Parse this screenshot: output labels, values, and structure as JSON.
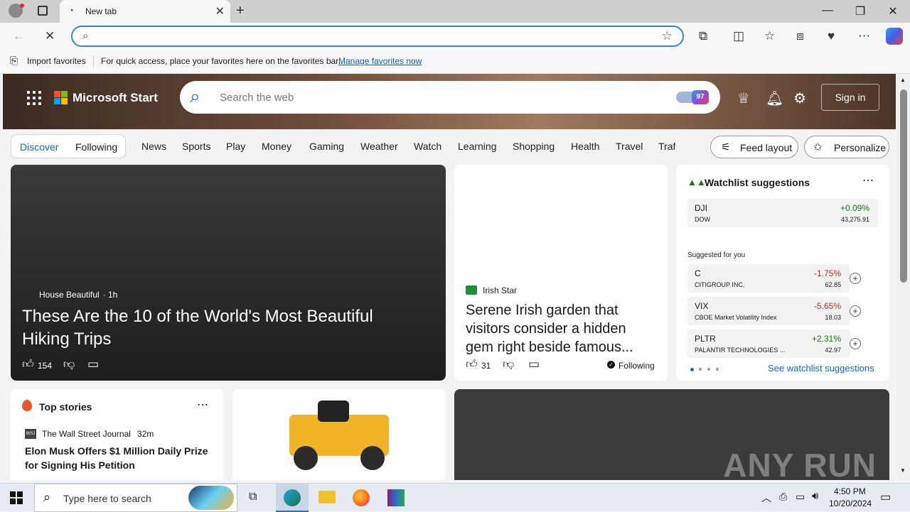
{
  "browser": {
    "tab_title": "New tab",
    "omnibox_value": "",
    "favorites_bar": {
      "import_label": "Import favorites",
      "hint": "For quick access, place your favorites here on the favorites bar.",
      "manage_link": "Manage favorites now"
    }
  },
  "header": {
    "brand": "Microsoft Start",
    "search_placeholder": "Search the web",
    "signin_label": "Sign in",
    "notification_count": "97"
  },
  "nav": {
    "pill": [
      "Discover",
      "Following"
    ],
    "items": [
      "News",
      "Sports",
      "Play",
      "Money",
      "Gaming",
      "Weather",
      "Watch",
      "Learning",
      "Shopping",
      "Health",
      "Travel",
      "Traf"
    ],
    "feed_layout": "Feed layout",
    "personalize": "Personalize"
  },
  "hero_card": {
    "source": "House Beautiful",
    "age": "1h",
    "headline": "These Are the 10 of the World's Most Beautiful Hiking Trips",
    "likes": "154"
  },
  "irish_card": {
    "source": "Irish Star",
    "headline": "Serene Irish garden that visitors consider a hidden gem right beside famous...",
    "likes": "31",
    "following_label": "Following"
  },
  "watchlist": {
    "title": "Watchlist suggestions",
    "main": {
      "symbol": "DJI",
      "name": "DOW",
      "change": "+0.09%",
      "price": "43,275.91"
    },
    "suggested_label": "Suggested for you",
    "suggested": [
      {
        "symbol": "C",
        "name": "CITIGROUP INC.",
        "change": "-1.75%",
        "price": "62.85"
      },
      {
        "symbol": "VIX",
        "name": "CBOE Market Volatility Index",
        "change": "-5.65%",
        "price": "18.03"
      },
      {
        "symbol": "PLTR",
        "name": "PALANTIR TECHNOLOGIES ...",
        "change": "+2.31%",
        "price": "42.97"
      }
    ],
    "see_more": "See watchlist suggestions"
  },
  "top_stories": {
    "title": "Top stories",
    "source": "The Wall Street Journal",
    "age": "32m",
    "headline": "Elon Musk Offers $1 Million Daily Prize for Signing His Petition"
  },
  "taskbar": {
    "search_placeholder": "Type here to search",
    "time": "4:50 PM",
    "date": "10/20/2024"
  },
  "watermark": "ANY RUN",
  "colors": {
    "accent": "#0f6cbd",
    "negative": "#c42b1c",
    "positive": "#107c10"
  }
}
